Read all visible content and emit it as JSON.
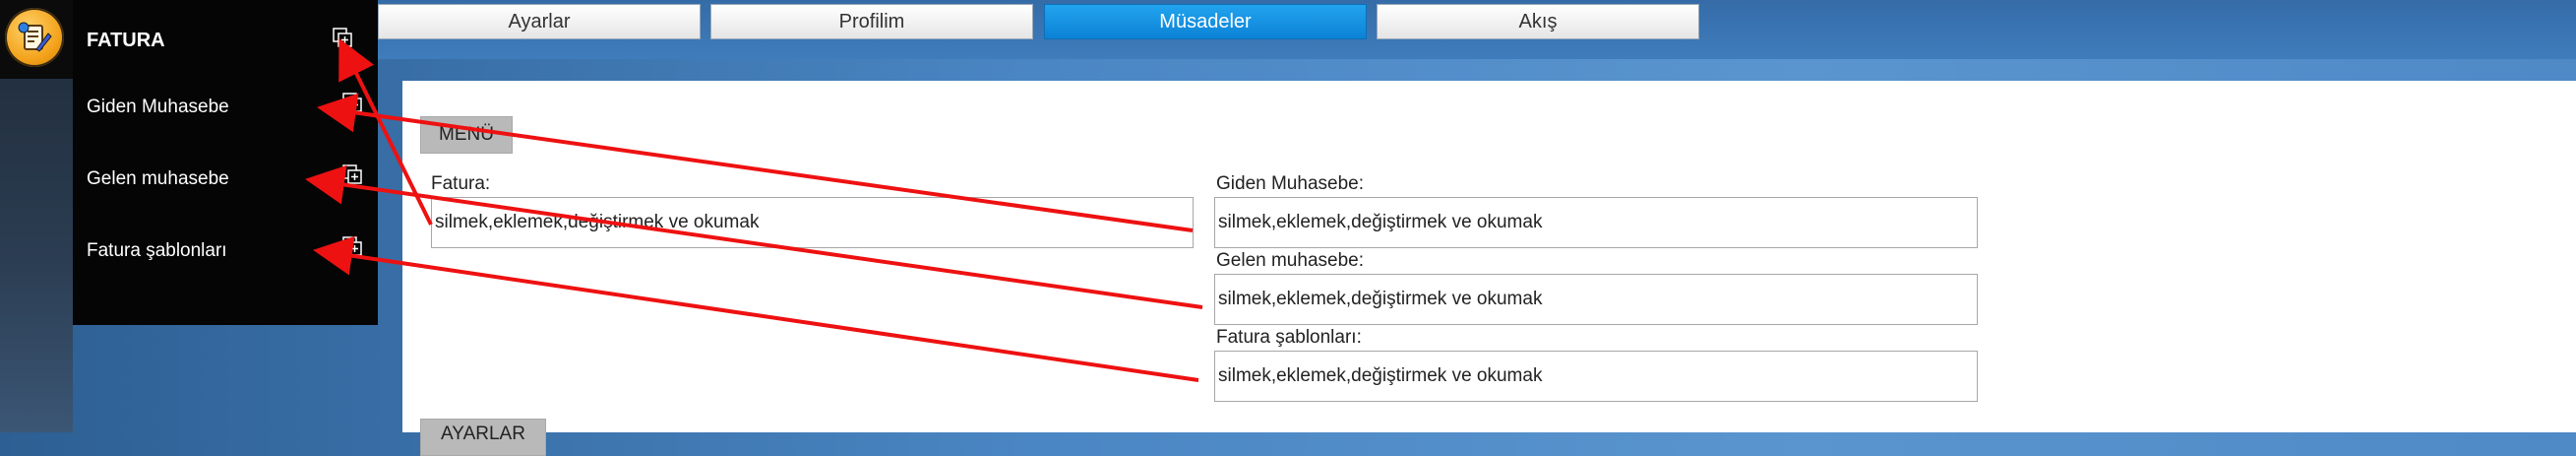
{
  "sidebar": {
    "header": "FATURA",
    "items": [
      {
        "label": "Giden Muhasebe"
      },
      {
        "label": "Gelen muhasebe"
      },
      {
        "label": "Fatura şablonları"
      }
    ]
  },
  "tabs": [
    {
      "label": "Ayarlar"
    },
    {
      "label": "Profilim"
    },
    {
      "label": "Müsadeler"
    },
    {
      "label": "Akış"
    }
  ],
  "active_tab": "Müsadeler",
  "main": {
    "menu_button": "MENÜ",
    "settings_button": "AYARLAR",
    "fields": [
      {
        "label": "Fatura:",
        "value": "silmek,eklemek,değiştirmek ve okumak"
      },
      {
        "label": "Giden Muhasebe:",
        "value": "silmek,eklemek,değiştirmek ve okumak"
      },
      {
        "label": "Gelen muhasebe:",
        "value": "silmek,eklemek,değiştirmek ve okumak"
      },
      {
        "label": "Fatura şablonları:",
        "value": "silmek,eklemek,değiştirmek ve okumak"
      }
    ]
  },
  "colors": {
    "active_tab": "#0c82d6",
    "sidebar_bg": "#050505",
    "annotation_arrow": "#ee1111"
  },
  "icons": {
    "logo": "invoice-pencil-icon",
    "add": "add-page-icon"
  }
}
